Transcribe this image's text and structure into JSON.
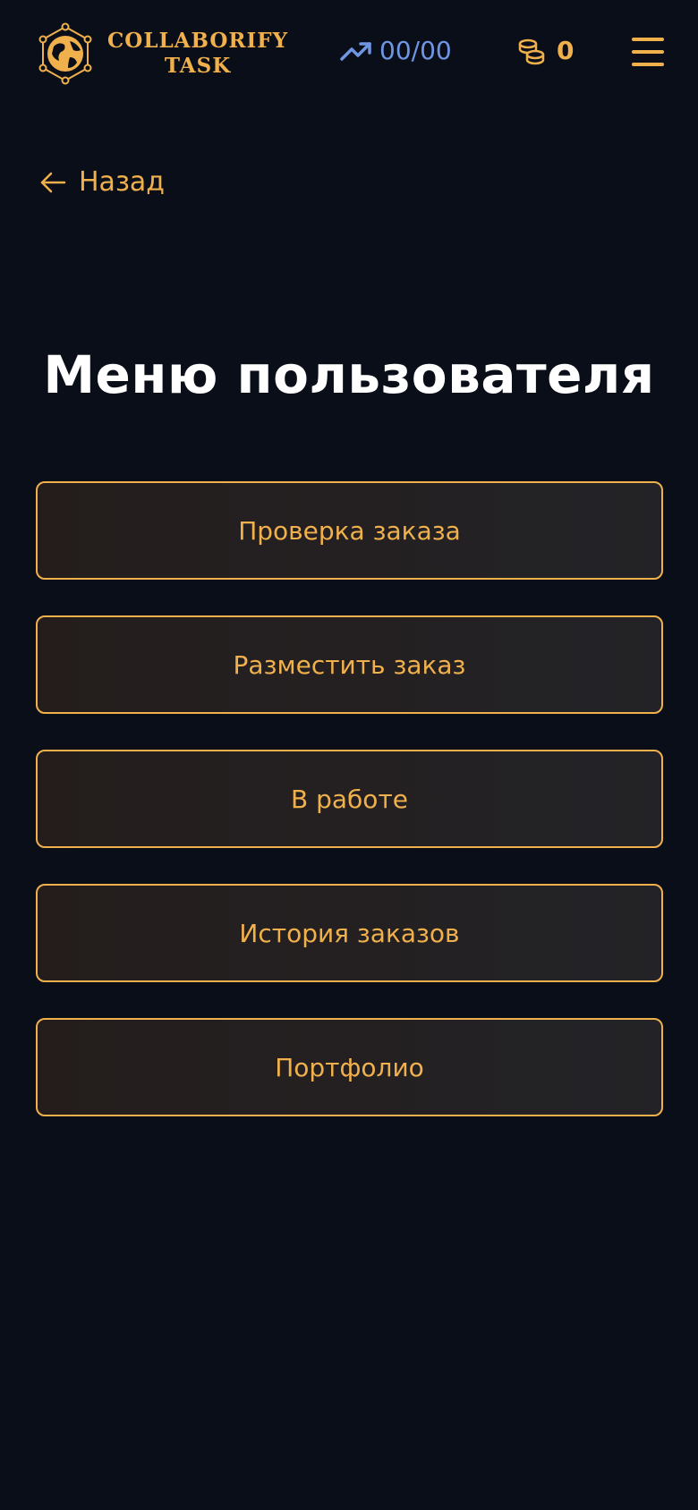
{
  "header": {
    "logo_line1": "COLLABORIFY",
    "logo_line2": "TASK",
    "progress_value": "00/00",
    "coins_value": "0",
    "icons": {
      "logo": "globe-network-icon",
      "progress": "trending-up-icon",
      "coins": "coins-stack-icon",
      "menu": "hamburger-menu-icon"
    }
  },
  "back": {
    "label": "Назад",
    "icon": "arrow-left-icon"
  },
  "page": {
    "title": "Меню пользователя"
  },
  "menu": {
    "items": [
      {
        "label": "Проверка заказа"
      },
      {
        "label": "Разместить заказ"
      },
      {
        "label": "В работе"
      },
      {
        "label": "История заказов"
      },
      {
        "label": "Портфолио"
      }
    ]
  },
  "colors": {
    "background": "#0a0e19",
    "accent": "#f0b04c",
    "progress": "#6f96e3",
    "button_bg": "#232327",
    "title": "#ffffff"
  }
}
